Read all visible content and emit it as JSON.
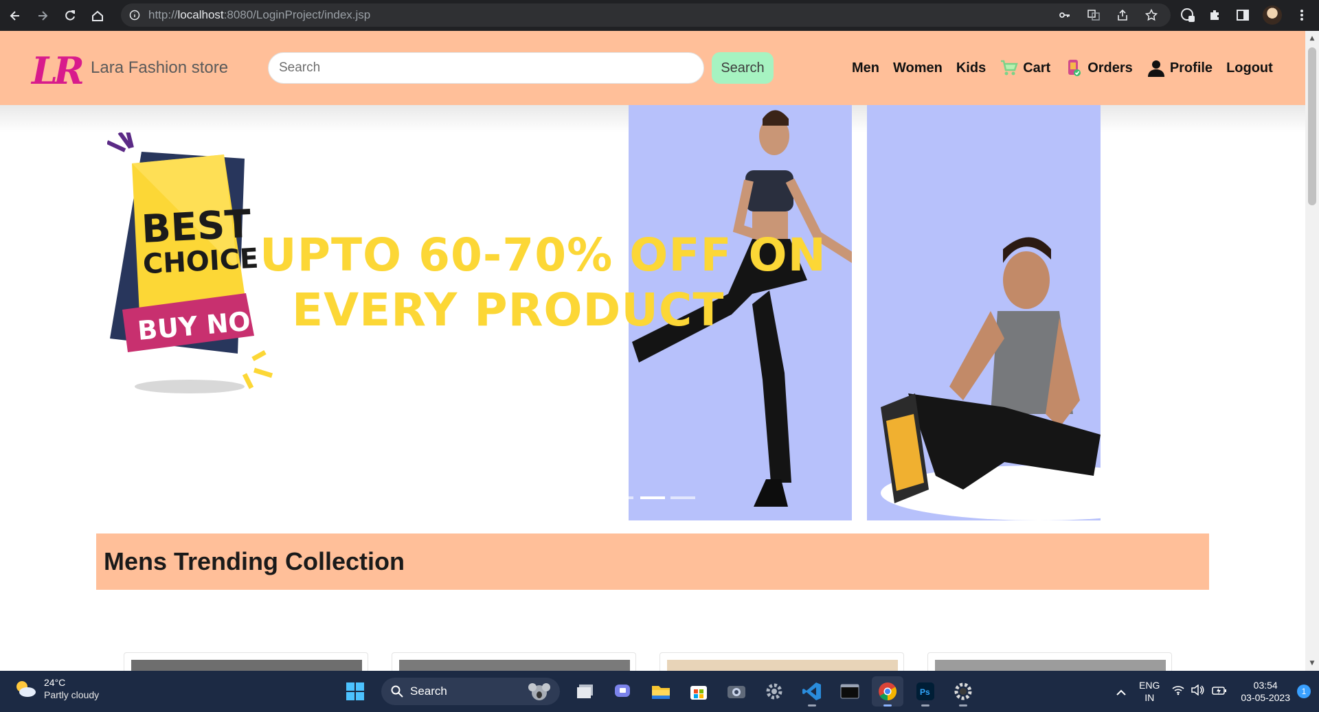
{
  "browser": {
    "url_prefix": "http://",
    "url_host": "localhost",
    "url_rest": ":8080/LoginProject/index.jsp"
  },
  "header": {
    "logo_text": "LR",
    "brand": "Lara Fashion store",
    "search_placeholder": "Search",
    "search_button": "Search",
    "nav": {
      "men": "Men",
      "women": "Women",
      "kids": "Kids",
      "cart": "Cart",
      "orders": "Orders",
      "profile": "Profile",
      "logout": "Logout"
    }
  },
  "hero": {
    "badge_line1": "BEST",
    "badge_line2": "CHOICE",
    "badge_cta": "BUY NOW",
    "promo_line1": "UPTO 60-70% OFF ON",
    "promo_line2": "EVERY PRODUCT"
  },
  "section": {
    "title": "Mens Trending Collection"
  },
  "taskbar": {
    "temperature": "24°C",
    "weather": "Partly cloudy",
    "search_label": "Search",
    "lang_line1": "ENG",
    "lang_line2": "IN",
    "time": "03:54",
    "date": "03-05-2023",
    "notifications": "1"
  },
  "colors": {
    "header_bg": "#ffbf99",
    "search_button_bg": "#a6f3c1",
    "promo_yellow": "#fcd736",
    "panel_blue": "#b7c1fb",
    "logo_pink": "#d81b8c"
  }
}
